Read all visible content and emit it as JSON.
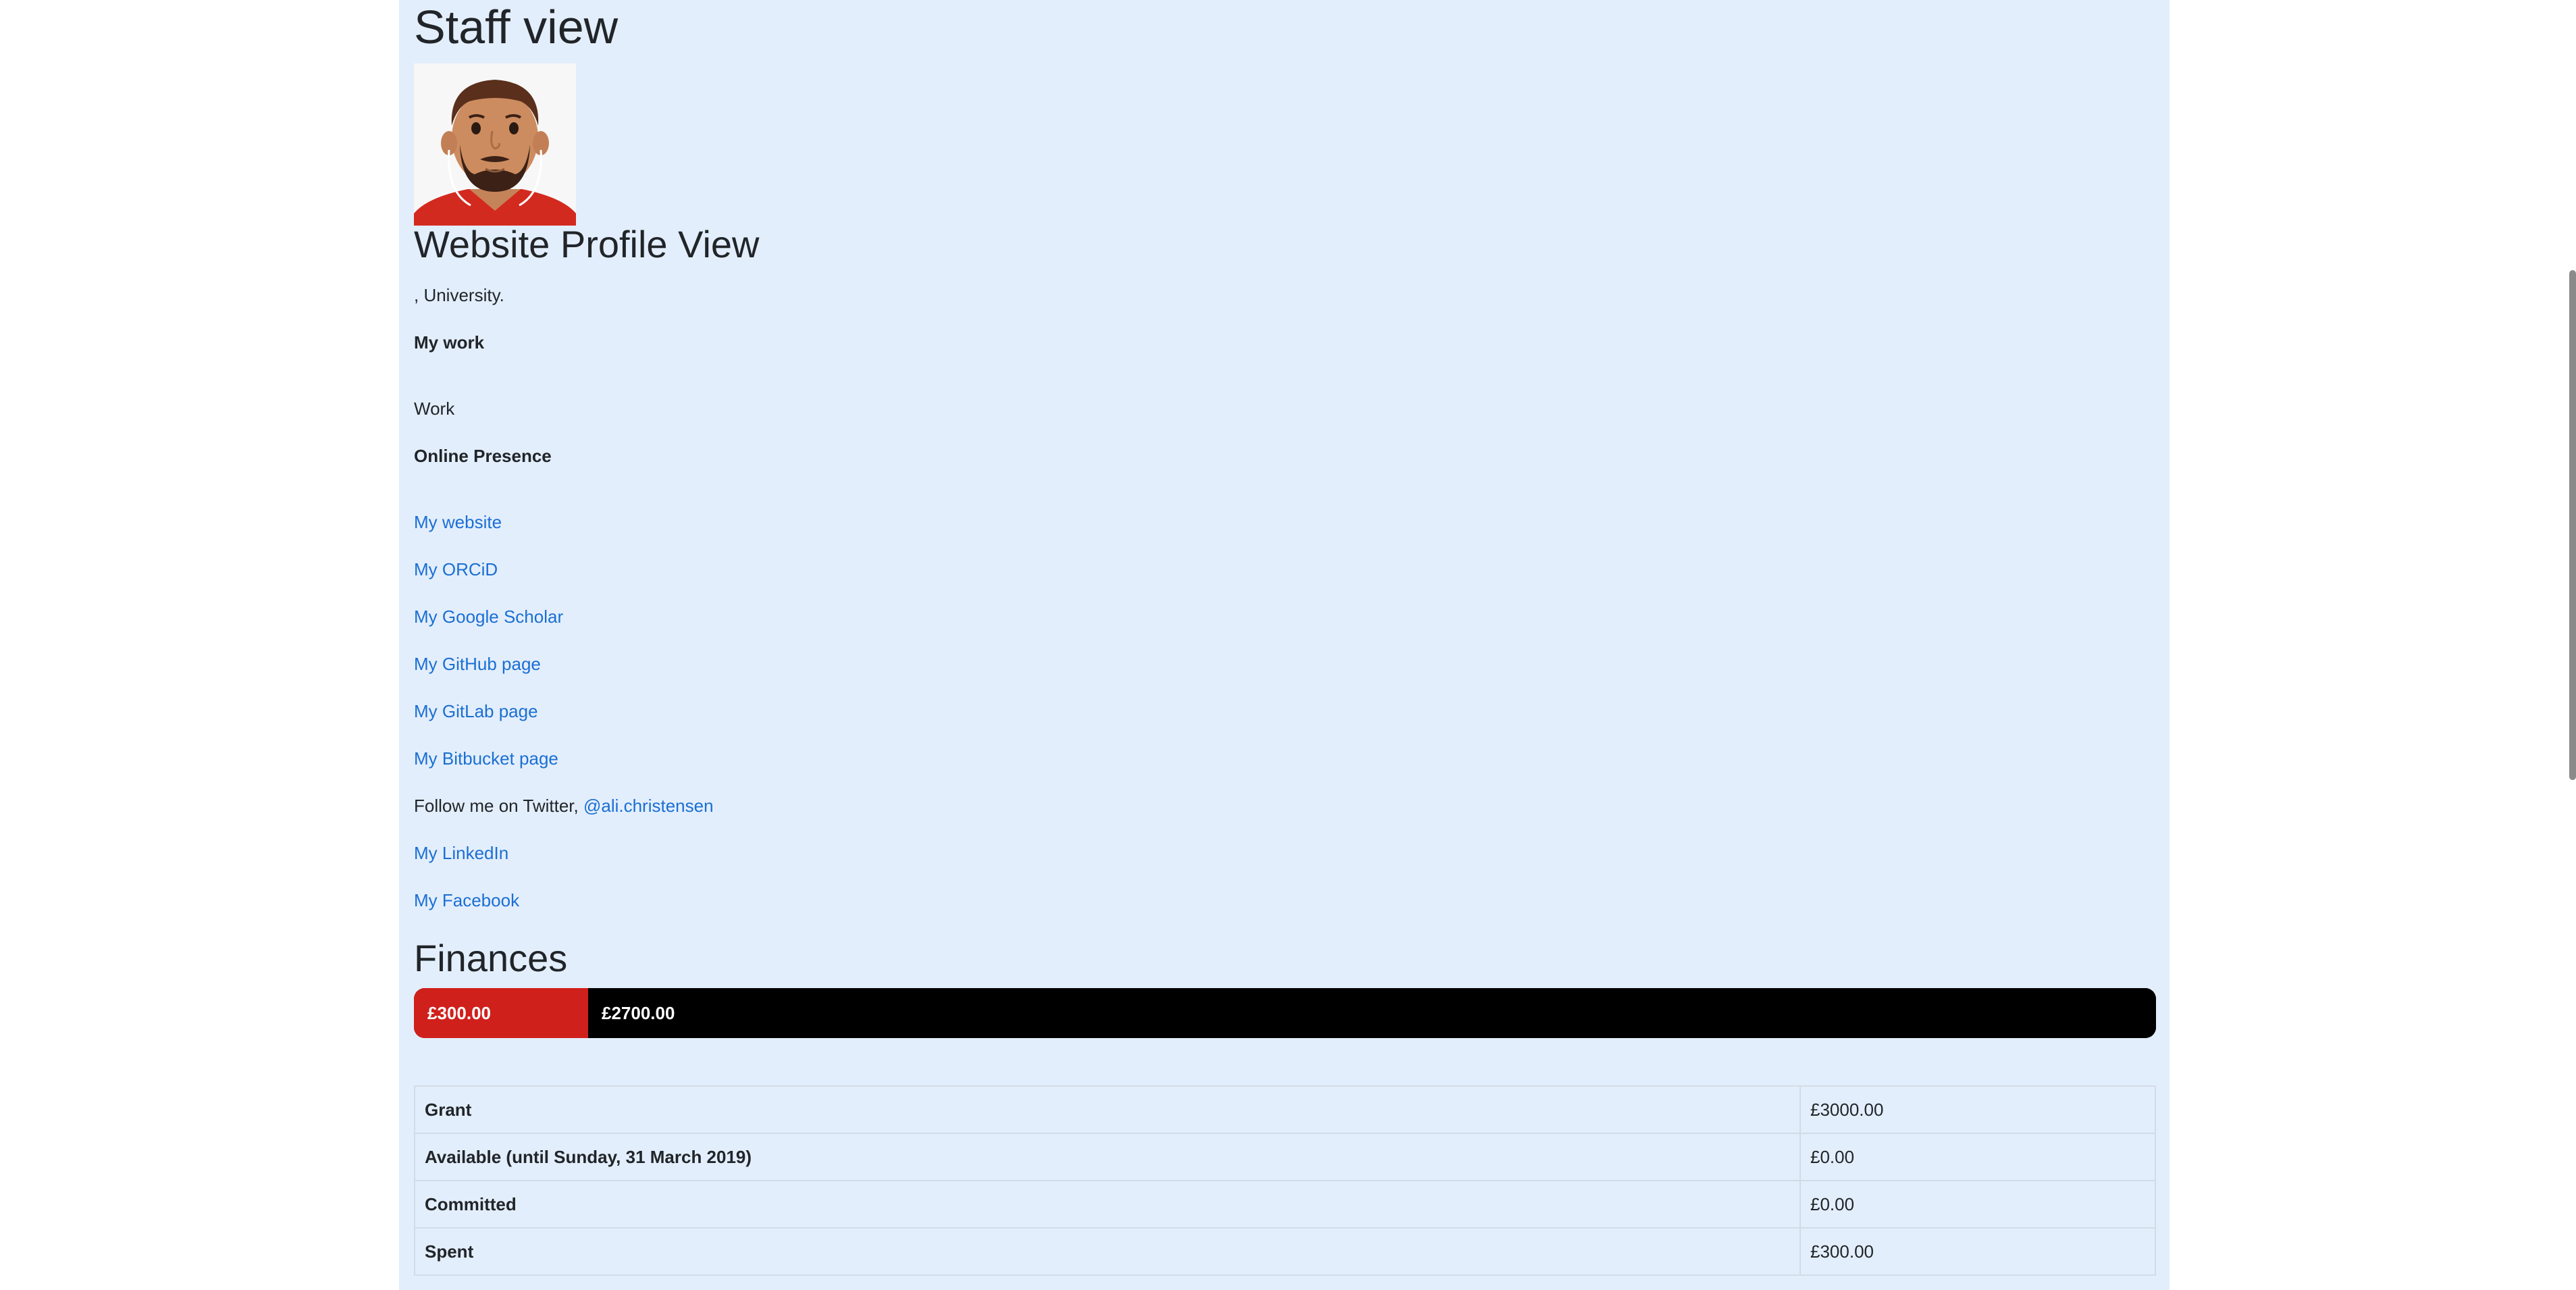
{
  "page": {
    "title": "Staff view"
  },
  "profile": {
    "avatar_icon": "avatar-man-beard-icon",
    "title": "Website Profile View",
    "affiliation": ", University.",
    "work_heading": "My work",
    "work_text": "Work",
    "online_heading": "Online Presence",
    "links": {
      "website": "My website",
      "orcid": "My ORCiD",
      "google_scholar": "My Google Scholar",
      "github": "My GitHub page",
      "gitlab": "My GitLab page",
      "bitbucket": "My Bitbucket page",
      "twitter_prefix": "Follow me on Twitter,",
      "twitter_handle": "@ali.christensen",
      "linkedin": "My LinkedIn",
      "facebook": "My Facebook"
    }
  },
  "finances": {
    "title": "Finances",
    "bar": {
      "spent_label": "£300.00",
      "remaining_label": "£2700.00",
      "spent_value": 300,
      "remaining_value": 2700,
      "spent_color": "#d0201c",
      "remaining_color": "#000000"
    },
    "rows": [
      {
        "label": "Grant",
        "value": "£3000.00"
      },
      {
        "label": "Available (until Sunday, 31 March 2019)",
        "value": "£0.00"
      },
      {
        "label": "Committed",
        "value": "£0.00"
      },
      {
        "label": "Spent",
        "value": "£300.00"
      }
    ]
  },
  "colors": {
    "background": "#e3eefc",
    "link": "#1a6fd4"
  }
}
